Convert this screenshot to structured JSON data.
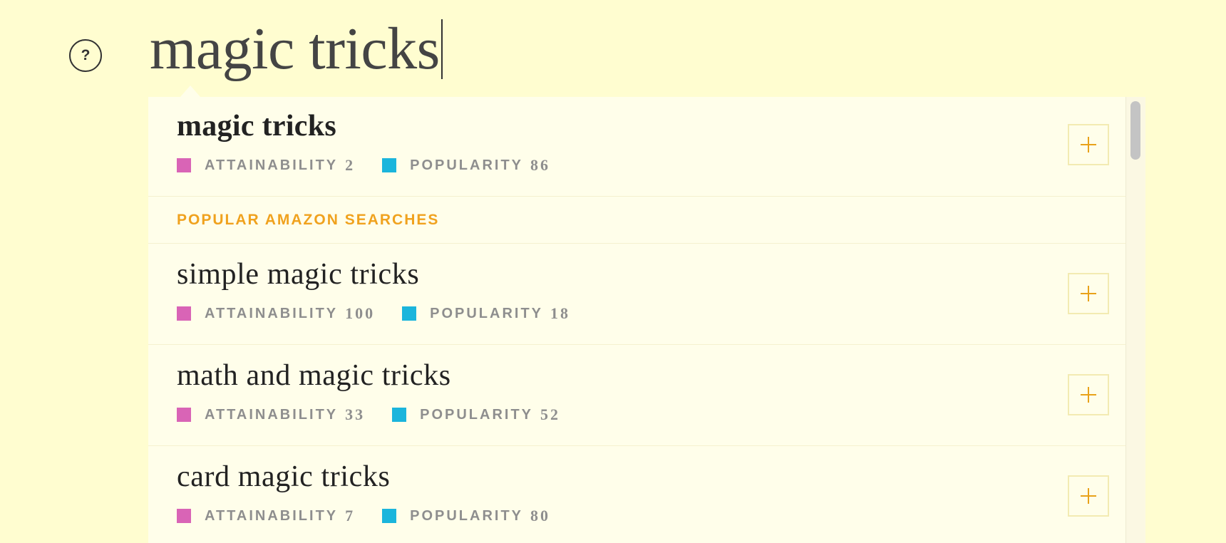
{
  "help": {
    "label": "?"
  },
  "search": {
    "query": "magic tricks"
  },
  "top_result": {
    "term": "magic tricks",
    "attainability_label": "ATTAINABILITY",
    "attainability": "2",
    "popularity_label": "POPULARITY",
    "popularity": "86"
  },
  "section": {
    "title": "POPULAR AMAZON SEARCHES"
  },
  "suggestions": [
    {
      "term": "simple magic tricks",
      "attainability_label": "ATTAINABILITY",
      "attainability": "100",
      "popularity_label": "POPULARITY",
      "popularity": "18"
    },
    {
      "term": "math and magic tricks",
      "attainability_label": "ATTAINABILITY",
      "attainability": "33",
      "popularity_label": "POPULARITY",
      "popularity": "52"
    },
    {
      "term": "card magic tricks",
      "attainability_label": "ATTAINABILITY",
      "attainability": "7",
      "popularity_label": "POPULARITY",
      "popularity": "80"
    }
  ],
  "colors": {
    "background": "#fffdd0",
    "panel": "#fffeea",
    "attainability": "#d964b6",
    "popularity": "#1bb5dc",
    "accent": "#f0a21e"
  },
  "icons": {
    "help": "question-circle-icon",
    "add": "plus-icon"
  }
}
